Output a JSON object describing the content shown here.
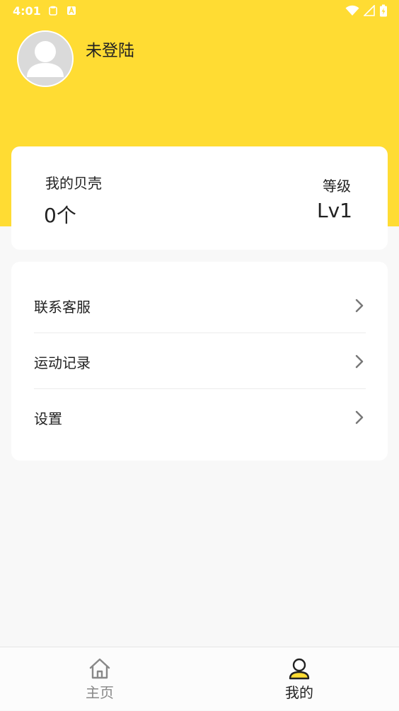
{
  "status_bar": {
    "time": "4:01"
  },
  "profile": {
    "username": "未登陆"
  },
  "stats": {
    "shells_label": "我的贝壳",
    "shells_value": "0个",
    "level_label": "等级",
    "level_value": "Lv1"
  },
  "menu": {
    "items": [
      {
        "label": "联系客服"
      },
      {
        "label": "运动记录"
      },
      {
        "label": "设置"
      }
    ]
  },
  "bottom_nav": {
    "items": [
      {
        "label": "主页",
        "active": false
      },
      {
        "label": "我的",
        "active": true
      }
    ]
  },
  "colors": {
    "accent": "#ffdc33",
    "background": "#f8f8f8",
    "card": "#ffffff",
    "inactive_nav": "#888888",
    "active_nav": "#222222"
  }
}
